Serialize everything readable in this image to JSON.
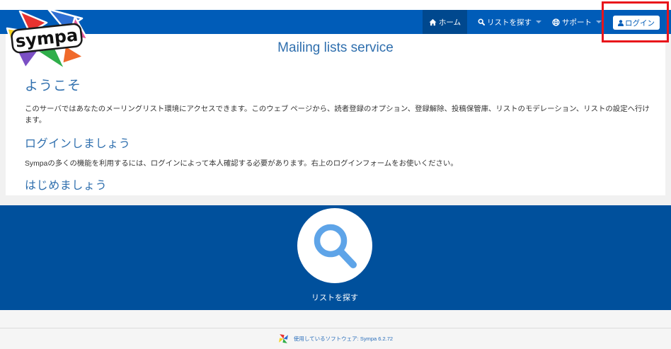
{
  "logo": {
    "text": "sympa",
    "icon": "sympa-logo"
  },
  "nav": {
    "home": {
      "label": "ホーム",
      "icon": "home-icon",
      "active": true
    },
    "find_list": {
      "label": "リストを探す",
      "icon": "search-icon",
      "dropdown_icon": "caret-down-icon"
    },
    "support": {
      "label": "サポート",
      "icon": "life-ring-icon",
      "dropdown_icon": "caret-down-icon"
    },
    "login": {
      "label": "ログイン",
      "icon": "user-icon"
    }
  },
  "main": {
    "title": "Mailing lists service",
    "welcome": {
      "heading": "ようこそ",
      "text": "このサーバではあなたのメーリングリスト環境にアクセスできます。このウェブ ページから、読者登録のオプション、登録解除、投稿保管庫、リストのモデレーション、リストの設定へ行けます。"
    },
    "login": {
      "heading": "ログインしましょう",
      "text": "Sympaの多くの機能を利用するには、ログインによって本人確認する必要があります。右上のログインフォームをお使いください。"
    },
    "get_started": {
      "heading": "はじめましょう"
    }
  },
  "feature": {
    "label": "リストを探す",
    "icon": "search-icon"
  },
  "footer": {
    "text": "使用しているソフトウェア: Sympa 6.2.72",
    "icon": "sympa-logo-icon"
  },
  "colors": {
    "nav": "#005cb8",
    "nav_active": "#00488e",
    "section": "#00509c",
    "heading": "#2f6fae",
    "link": "#2a6ebb",
    "highlight": "#e8141b"
  }
}
